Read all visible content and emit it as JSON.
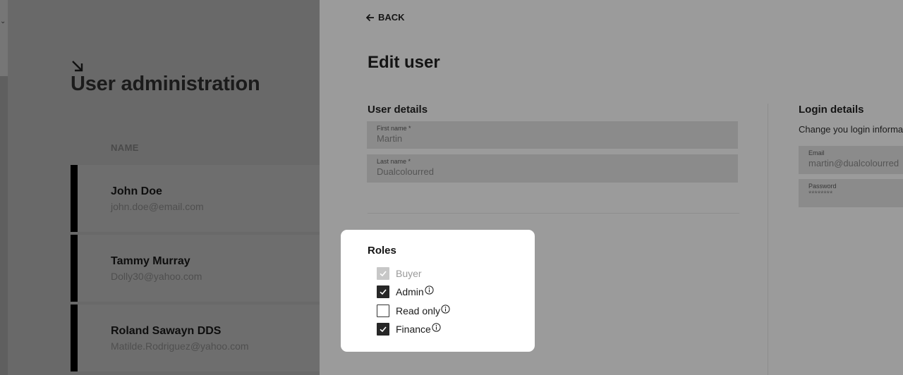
{
  "left": {
    "title": "User administration",
    "column_header": "NAME",
    "users": [
      {
        "name": "John Doe",
        "email": "john.doe@email.com"
      },
      {
        "name": "Tammy Murray",
        "email": "Dolly30@yahoo.com"
      },
      {
        "name": "Roland Sawayn DDS",
        "email": "Matilde.Rodriguez@yahoo.com"
      }
    ]
  },
  "panel": {
    "back_label": "BACK",
    "title": "Edit user",
    "user_details": {
      "title": "User details",
      "first_name": {
        "label": "First name *",
        "value": "Martin"
      },
      "last_name": {
        "label": "Last name *",
        "value": "Dualcolourred"
      }
    },
    "login_details": {
      "title": "Login details",
      "subtitle": "Change you login informa",
      "email": {
        "label": "Email",
        "value": "martin@dualcolourred"
      },
      "password": {
        "label": "Password",
        "value": "********"
      }
    },
    "roles": {
      "title": "Roles",
      "items": [
        {
          "label": "Buyer",
          "state": "checked-disabled",
          "info": false
        },
        {
          "label": "Admin",
          "state": "checked",
          "info": true
        },
        {
          "label": "Read only",
          "state": "unchecked",
          "info": true
        },
        {
          "label": "Finance",
          "state": "checked",
          "info": true
        }
      ]
    }
  },
  "colors": {
    "overlay_left": "#696969",
    "overlay_panel": "#9b9b9b",
    "card": "#ffffff",
    "checkbox_checked": "#272727",
    "checkbox_disabled": "#c7c7c7"
  }
}
